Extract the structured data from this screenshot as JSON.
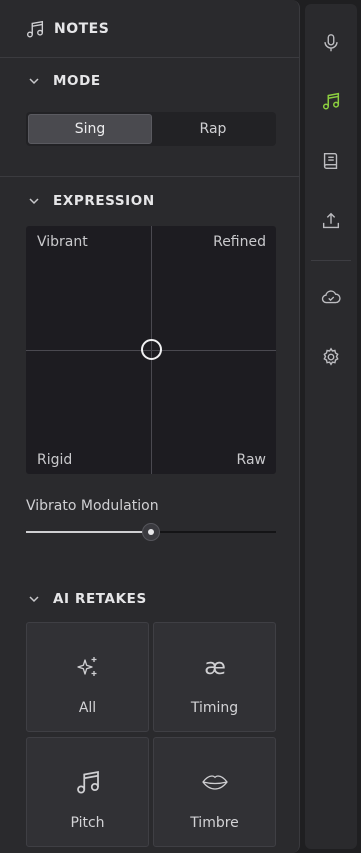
{
  "panel": {
    "title": "NOTES"
  },
  "mode": {
    "heading": "MODE",
    "options": [
      "Sing",
      "Rap"
    ],
    "selected": "Sing"
  },
  "expression": {
    "heading": "EXPRESSION",
    "corners": {
      "top_left": "Vibrant",
      "top_right": "Refined",
      "bottom_left": "Rigid",
      "bottom_right": "Raw"
    }
  },
  "vibrato": {
    "label": "Vibrato Modulation",
    "value_fraction": 0.5
  },
  "ai_retakes": {
    "heading": "AI RETAKES",
    "cards": [
      {
        "label": "All",
        "icon": "sparkles-icon"
      },
      {
        "label": "Timing",
        "icon": "ae-ligature-icon"
      },
      {
        "label": "Pitch",
        "icon": "music-notes-icon"
      },
      {
        "label": "Timbre",
        "icon": "lips-icon"
      }
    ]
  },
  "rail": {
    "items": [
      "microphone-icon",
      "music-note-icon",
      "book-icon",
      "upload-icon",
      "cloud-icon",
      "gear-icon"
    ],
    "active": "music-note-icon",
    "accent": "#8ccf3f"
  }
}
